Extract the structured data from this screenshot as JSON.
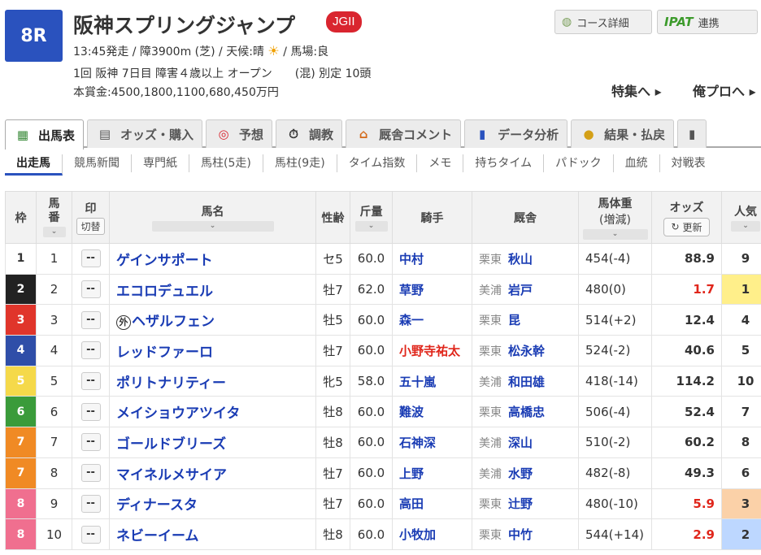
{
  "race": {
    "number": "8R",
    "title": "阪神スプリングジャンプ",
    "grade": "JGII",
    "info1_a": "13:45発走 / 障3900m (芝) / 天候:晴",
    "info1_b": "/ 馬場:良",
    "info2_a": "1回 阪神 7日目 障害４歳以上 オープン",
    "info2_b": "(混) 別定 10頭",
    "info3": "本賞金:4500,1800,1100,680,450万円"
  },
  "header_buttons": {
    "course": "コース詳細",
    "ipat_logo": "IPAT",
    "ipat": "連携",
    "toku": "特集へ ▸",
    "ore": "俺プロへ ▸"
  },
  "tabs": [
    {
      "label": "出馬表",
      "icon": "▦"
    },
    {
      "label": "オッズ・購入",
      "icon": "▤"
    },
    {
      "label": "予想",
      "icon": "◎"
    },
    {
      "label": "調教",
      "icon": "⏱"
    },
    {
      "label": "厩舎コメント",
      "icon": "⌂"
    },
    {
      "label": "データ分析",
      "icon": "▮"
    },
    {
      "label": "結果・払戻",
      "icon": "●"
    }
  ],
  "subnav": [
    "出走馬",
    "競馬新聞",
    "専門紙",
    "馬柱(5走)",
    "馬柱(9走)",
    "タイム指数",
    "メモ",
    "持ちタイム",
    "パドック",
    "血統",
    "対戦表"
  ],
  "columns": {
    "waku": "枠",
    "umaban": "馬番",
    "mark": "印",
    "kirikae": "切替",
    "horse": "馬名",
    "sexage": "性齢",
    "kinryo": "斤量",
    "jockey": "騎手",
    "stable": "厩舎",
    "weight1": "馬体重",
    "weight2": "(増減)",
    "odds": "オッズ",
    "reload": "更新",
    "pop": "人気"
  },
  "rows": [
    {
      "waku": "1",
      "umaban": "1",
      "mark": "--",
      "gai": "",
      "horse": "ゲインサポート",
      "sexage": "セ5",
      "kinryo": "60.0",
      "jockey": "中村",
      "area": "栗東",
      "trainer": "秋山",
      "weight": "454(-4)",
      "odds": "88.9",
      "pop": "9"
    },
    {
      "waku": "2",
      "umaban": "2",
      "mark": "--",
      "gai": "",
      "horse": "エコロデュエル",
      "sexage": "牡7",
      "kinryo": "62.0",
      "jockey": "草野",
      "area": "美浦",
      "trainer": "岩戸",
      "weight": "480(0)",
      "odds": "1.7",
      "pop": "1"
    },
    {
      "waku": "3",
      "umaban": "3",
      "mark": "--",
      "gai": "外",
      "horse": "ヘザルフェン",
      "sexage": "牡5",
      "kinryo": "60.0",
      "jockey": "森一",
      "area": "栗東",
      "trainer": "昆",
      "weight": "514(+2)",
      "odds": "12.4",
      "pop": "4"
    },
    {
      "waku": "4",
      "umaban": "4",
      "mark": "--",
      "gai": "",
      "horse": "レッドファーロ",
      "sexage": "牡7",
      "kinryo": "60.0",
      "jockey": "小野寺祐太",
      "area": "栗東",
      "trainer": "松永幹",
      "weight": "524(-2)",
      "odds": "40.6",
      "pop": "5"
    },
    {
      "waku": "5",
      "umaban": "5",
      "mark": "--",
      "gai": "",
      "horse": "ポリトナリティー",
      "sexage": "牝5",
      "kinryo": "58.0",
      "jockey": "五十嵐",
      "area": "美浦",
      "trainer": "和田雄",
      "weight": "418(-14)",
      "odds": "114.2",
      "pop": "10"
    },
    {
      "waku": "6",
      "umaban": "6",
      "mark": "--",
      "gai": "",
      "horse": "メイショウアツイタ",
      "sexage": "牡8",
      "kinryo": "60.0",
      "jockey": "難波",
      "area": "栗東",
      "trainer": "高橋忠",
      "weight": "506(-4)",
      "odds": "52.4",
      "pop": "7"
    },
    {
      "waku": "7",
      "umaban": "7",
      "mark": "--",
      "gai": "",
      "horse": "ゴールドブリーズ",
      "sexage": "牡8",
      "kinryo": "60.0",
      "jockey": "石神深",
      "area": "美浦",
      "trainer": "深山",
      "weight": "510(-2)",
      "odds": "60.2",
      "pop": "8"
    },
    {
      "waku": "7",
      "umaban": "8",
      "mark": "--",
      "gai": "",
      "horse": "マイネルメサイア",
      "sexage": "牡7",
      "kinryo": "60.0",
      "jockey": "上野",
      "area": "美浦",
      "trainer": "水野",
      "weight": "482(-8)",
      "odds": "49.3",
      "pop": "6"
    },
    {
      "waku": "8",
      "umaban": "9",
      "mark": "--",
      "gai": "",
      "horse": "ディナースタ",
      "sexage": "牡7",
      "kinryo": "60.0",
      "jockey": "高田",
      "area": "栗東",
      "trainer": "辻野",
      "weight": "480(-10)",
      "odds": "5.9",
      "pop": "3"
    },
    {
      "waku": "8",
      "umaban": "10",
      "mark": "--",
      "gai": "",
      "horse": "ネビーイーム",
      "sexage": "牡8",
      "kinryo": "60.0",
      "jockey": "小牧加",
      "area": "栗東",
      "trainer": "中竹",
      "weight": "544(+14)",
      "odds": "2.9",
      "pop": "2"
    }
  ],
  "colors": {
    "waku_1": "#ffffff",
    "waku_2": "#222222",
    "waku_3": "#e0352b",
    "waku_4": "#2f4ea8",
    "waku_5": "#f5d94a",
    "waku_6": "#3a9b3a",
    "waku_7": "#f08a24",
    "waku_8": "#f06f8f",
    "accent": "#2a52be",
    "odds_red": "#e0261b"
  }
}
